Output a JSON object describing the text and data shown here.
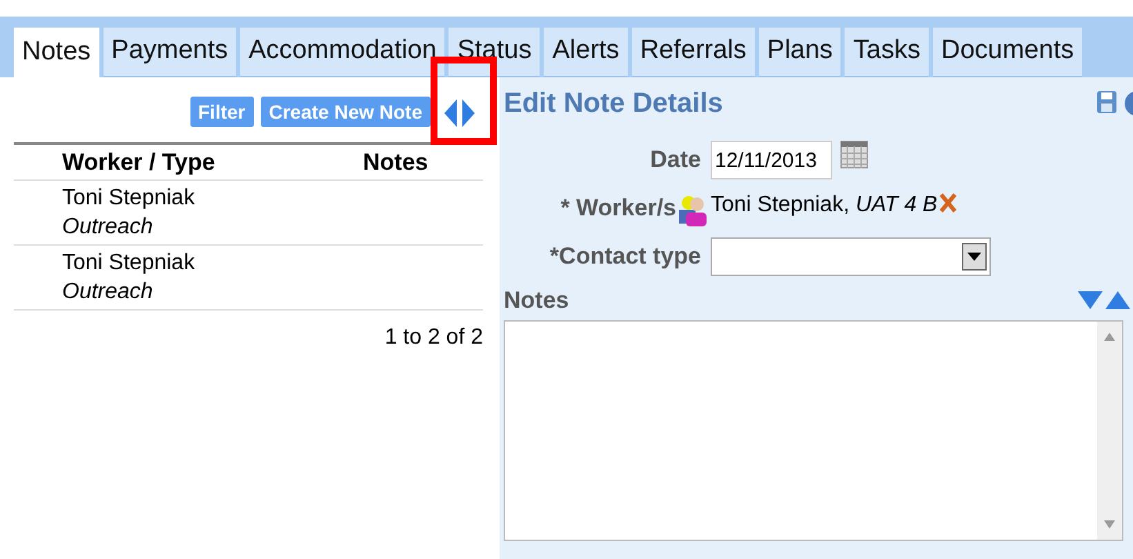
{
  "tabs": [
    {
      "label": "Notes",
      "selected": true
    },
    {
      "label": "Payments",
      "selected": false
    },
    {
      "label": "Accommodation",
      "selected": false
    },
    {
      "label": "Status",
      "selected": false
    },
    {
      "label": "Alerts",
      "selected": false
    },
    {
      "label": "Referrals",
      "selected": false
    },
    {
      "label": "Plans",
      "selected": false
    },
    {
      "label": "Tasks",
      "selected": false
    },
    {
      "label": "Documents",
      "selected": false
    }
  ],
  "toolbar": {
    "buttons": [
      "Filter",
      "Create New Note"
    ]
  },
  "splitter": {
    "highlighted": true
  },
  "table": {
    "columns": [
      "Worker / Type",
      "Notes"
    ],
    "rows": [
      {
        "worker": "Toni Stepniak",
        "type": "Outreach"
      },
      {
        "worker": "Toni Stepniak",
        "type": "Outreach"
      }
    ],
    "pagination": "1 to 2 of 2"
  },
  "edit_panel": {
    "title": "Edit Note Details",
    "date": {
      "label": "Date",
      "value": "12/11/2013"
    },
    "workers": {
      "label": "* Worker/s",
      "value": "Toni Stepniak, *UAT 4 B*"
    },
    "contact_type": {
      "label": "*Contact type"
    },
    "notes": {
      "label": "Notes"
    }
  }
}
